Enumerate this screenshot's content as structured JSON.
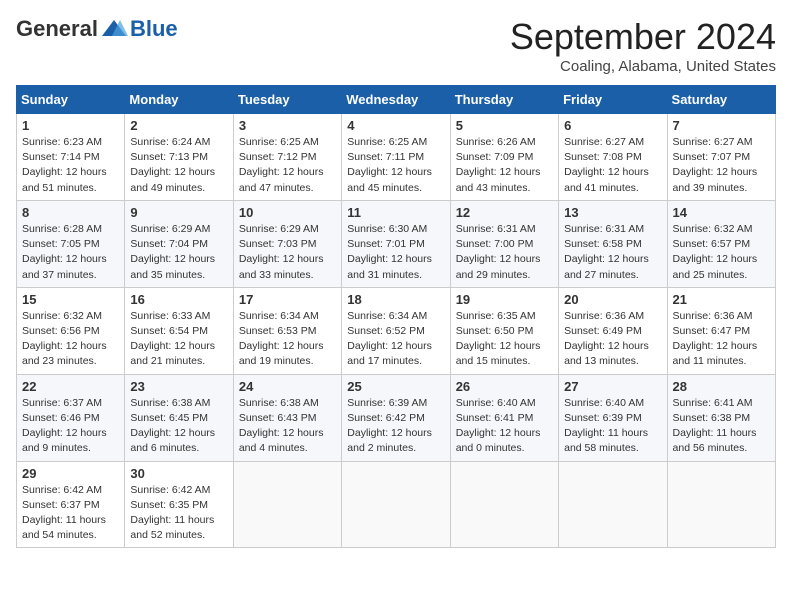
{
  "header": {
    "logo_general": "General",
    "logo_blue": "Blue",
    "month_title": "September 2024",
    "location": "Coaling, Alabama, United States"
  },
  "days_of_week": [
    "Sunday",
    "Monday",
    "Tuesday",
    "Wednesday",
    "Thursday",
    "Friday",
    "Saturday"
  ],
  "weeks": [
    [
      {
        "day": "1",
        "sunrise": "6:23 AM",
        "sunset": "7:14 PM",
        "daylight": "12 hours and 51 minutes."
      },
      {
        "day": "2",
        "sunrise": "6:24 AM",
        "sunset": "7:13 PM",
        "daylight": "12 hours and 49 minutes."
      },
      {
        "day": "3",
        "sunrise": "6:25 AM",
        "sunset": "7:12 PM",
        "daylight": "12 hours and 47 minutes."
      },
      {
        "day": "4",
        "sunrise": "6:25 AM",
        "sunset": "7:11 PM",
        "daylight": "12 hours and 45 minutes."
      },
      {
        "day": "5",
        "sunrise": "6:26 AM",
        "sunset": "7:09 PM",
        "daylight": "12 hours and 43 minutes."
      },
      {
        "day": "6",
        "sunrise": "6:27 AM",
        "sunset": "7:08 PM",
        "daylight": "12 hours and 41 minutes."
      },
      {
        "day": "7",
        "sunrise": "6:27 AM",
        "sunset": "7:07 PM",
        "daylight": "12 hours and 39 minutes."
      }
    ],
    [
      {
        "day": "8",
        "sunrise": "6:28 AM",
        "sunset": "7:05 PM",
        "daylight": "12 hours and 37 minutes."
      },
      {
        "day": "9",
        "sunrise": "6:29 AM",
        "sunset": "7:04 PM",
        "daylight": "12 hours and 35 minutes."
      },
      {
        "day": "10",
        "sunrise": "6:29 AM",
        "sunset": "7:03 PM",
        "daylight": "12 hours and 33 minutes."
      },
      {
        "day": "11",
        "sunrise": "6:30 AM",
        "sunset": "7:01 PM",
        "daylight": "12 hours and 31 minutes."
      },
      {
        "day": "12",
        "sunrise": "6:31 AM",
        "sunset": "7:00 PM",
        "daylight": "12 hours and 29 minutes."
      },
      {
        "day": "13",
        "sunrise": "6:31 AM",
        "sunset": "6:58 PM",
        "daylight": "12 hours and 27 minutes."
      },
      {
        "day": "14",
        "sunrise": "6:32 AM",
        "sunset": "6:57 PM",
        "daylight": "12 hours and 25 minutes."
      }
    ],
    [
      {
        "day": "15",
        "sunrise": "6:32 AM",
        "sunset": "6:56 PM",
        "daylight": "12 hours and 23 minutes."
      },
      {
        "day": "16",
        "sunrise": "6:33 AM",
        "sunset": "6:54 PM",
        "daylight": "12 hours and 21 minutes."
      },
      {
        "day": "17",
        "sunrise": "6:34 AM",
        "sunset": "6:53 PM",
        "daylight": "12 hours and 19 minutes."
      },
      {
        "day": "18",
        "sunrise": "6:34 AM",
        "sunset": "6:52 PM",
        "daylight": "12 hours and 17 minutes."
      },
      {
        "day": "19",
        "sunrise": "6:35 AM",
        "sunset": "6:50 PM",
        "daylight": "12 hours and 15 minutes."
      },
      {
        "day": "20",
        "sunrise": "6:36 AM",
        "sunset": "6:49 PM",
        "daylight": "12 hours and 13 minutes."
      },
      {
        "day": "21",
        "sunrise": "6:36 AM",
        "sunset": "6:47 PM",
        "daylight": "12 hours and 11 minutes."
      }
    ],
    [
      {
        "day": "22",
        "sunrise": "6:37 AM",
        "sunset": "6:46 PM",
        "daylight": "12 hours and 9 minutes."
      },
      {
        "day": "23",
        "sunrise": "6:38 AM",
        "sunset": "6:45 PM",
        "daylight": "12 hours and 6 minutes."
      },
      {
        "day": "24",
        "sunrise": "6:38 AM",
        "sunset": "6:43 PM",
        "daylight": "12 hours and 4 minutes."
      },
      {
        "day": "25",
        "sunrise": "6:39 AM",
        "sunset": "6:42 PM",
        "daylight": "12 hours and 2 minutes."
      },
      {
        "day": "26",
        "sunrise": "6:40 AM",
        "sunset": "6:41 PM",
        "daylight": "12 hours and 0 minutes."
      },
      {
        "day": "27",
        "sunrise": "6:40 AM",
        "sunset": "6:39 PM",
        "daylight": "11 hours and 58 minutes."
      },
      {
        "day": "28",
        "sunrise": "6:41 AM",
        "sunset": "6:38 PM",
        "daylight": "11 hours and 56 minutes."
      }
    ],
    [
      {
        "day": "29",
        "sunrise": "6:42 AM",
        "sunset": "6:37 PM",
        "daylight": "11 hours and 54 minutes."
      },
      {
        "day": "30",
        "sunrise": "6:42 AM",
        "sunset": "6:35 PM",
        "daylight": "11 hours and 52 minutes."
      },
      null,
      null,
      null,
      null,
      null
    ]
  ]
}
